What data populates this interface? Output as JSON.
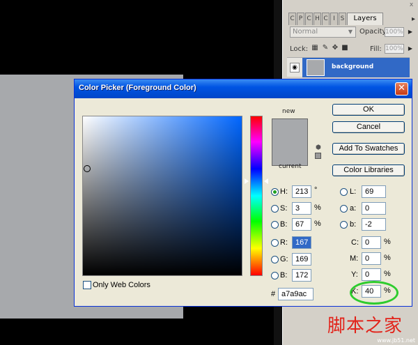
{
  "layers_panel": {
    "tabs": [
      "C",
      "P",
      "C",
      "H",
      "C",
      "I",
      "S"
    ],
    "active_tab": "Layers",
    "close_glyph": "x",
    "blend_mode": "Normal",
    "opacity_label": "Opacity:",
    "opacity_value": "100%",
    "lock_label": "Lock:",
    "fill_label": "Fill:",
    "fill_value": "100%",
    "layer_name": "background"
  },
  "dialog": {
    "title": "Color Picker (Foreground Color)",
    "close_glyph": "✕",
    "new_label": "new",
    "current_label": "current",
    "buttons": {
      "ok": "OK",
      "cancel": "Cancel",
      "add_to_swatches": "Add To Swatches",
      "color_libraries": "Color Libraries"
    },
    "fields": {
      "H": {
        "label": "H:",
        "value": "213",
        "unit": "°"
      },
      "S": {
        "label": "S:",
        "value": "3",
        "unit": "%"
      },
      "B": {
        "label": "B:",
        "value": "67",
        "unit": "%"
      },
      "R": {
        "label": "R:",
        "value": "167"
      },
      "G": {
        "label": "G:",
        "value": "169"
      },
      "Bl": {
        "label": "B:",
        "value": "172"
      },
      "L": {
        "label": "L:",
        "value": "69"
      },
      "a": {
        "label": "a:",
        "value": "0"
      },
      "b": {
        "label": "b:",
        "value": "-2"
      },
      "C": {
        "label": "C:",
        "value": "0",
        "unit": "%"
      },
      "M": {
        "label": "M:",
        "value": "0",
        "unit": "%"
      },
      "Y": {
        "label": "Y:",
        "value": "0",
        "unit": "%"
      },
      "K": {
        "label": "K:",
        "value": "40",
        "unit": "%"
      },
      "hex": {
        "label": "#",
        "value": "a7a9ac"
      }
    },
    "only_web_colors_label": "Only Web Colors",
    "selected_color": "#a7a9ac"
  },
  "watermark": {
    "chinese": "脚本之家",
    "url": "www.jb51.net"
  }
}
